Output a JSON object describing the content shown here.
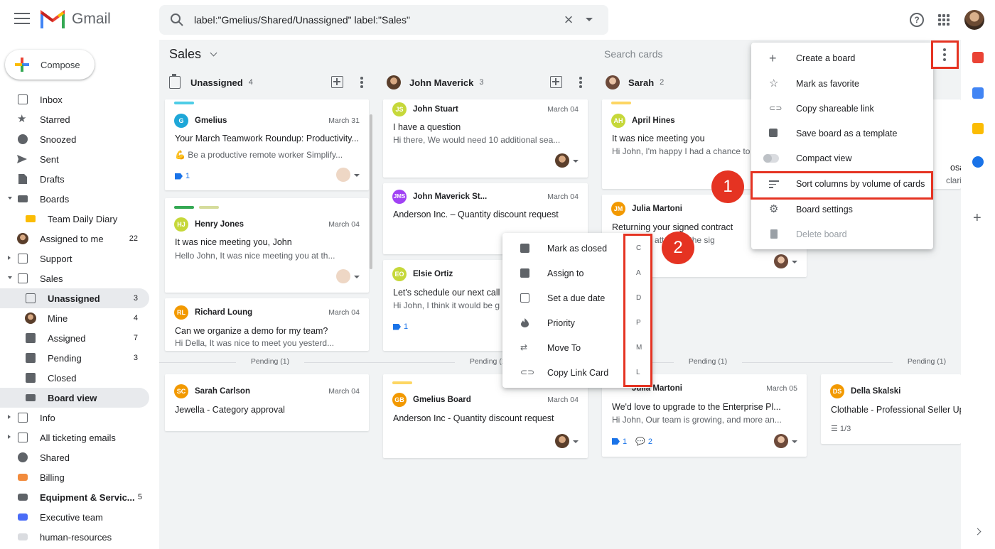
{
  "app": {
    "logo_text": "Gmail"
  },
  "search": {
    "query": "label:\"Gmelius/Shared/Unassigned\" label:\"Sales\""
  },
  "sidebar": {
    "compose": "Compose",
    "items": [
      {
        "label": "Inbox",
        "count": ""
      },
      {
        "label": "Starred",
        "count": ""
      },
      {
        "label": "Snoozed",
        "count": ""
      },
      {
        "label": "Sent",
        "count": ""
      },
      {
        "label": "Drafts",
        "count": ""
      },
      {
        "label": "Boards",
        "count": ""
      },
      {
        "label": "Team Daily Diary",
        "count": ""
      },
      {
        "label": "Assigned to me",
        "count": "22"
      },
      {
        "label": "Support",
        "count": ""
      },
      {
        "label": "Sales",
        "count": ""
      },
      {
        "label": "Unassigned",
        "count": "3"
      },
      {
        "label": "Mine",
        "count": "4"
      },
      {
        "label": "Assigned",
        "count": "7"
      },
      {
        "label": "Pending",
        "count": "3"
      },
      {
        "label": "Closed",
        "count": ""
      },
      {
        "label": "Board view",
        "count": ""
      },
      {
        "label": "Info",
        "count": ""
      },
      {
        "label": "All ticketing emails",
        "count": ""
      },
      {
        "label": "Shared",
        "count": ""
      },
      {
        "label": "Billing",
        "count": ""
      },
      {
        "label": "Equipment & Servic...",
        "count": "5"
      },
      {
        "label": "Executive team",
        "count": ""
      },
      {
        "label": "human-resources",
        "count": ""
      }
    ]
  },
  "board": {
    "title": "Sales",
    "search_placeholder": "Search cards",
    "pending_label": "Pending (1)",
    "columns": [
      {
        "name": "Unassigned",
        "count": "4",
        "cards": [
          {
            "from": "Gmelius",
            "initials": "G",
            "date": "March 31",
            "subject": "Your March Teamwork Roundup: Productivity...",
            "snippet": "💪 Be a productive remote worker Simplify...",
            "tag_count": "1"
          },
          {
            "from": "Henry Jones",
            "initials": "HJ",
            "date": "March 04",
            "subject": "It was nice meeting you, John",
            "snippet": "Hello John, It was nice meeting you at th..."
          },
          {
            "from": "Richard Loung",
            "initials": "RL",
            "date": "March 04",
            "subject": "Can we organize a demo for my team?",
            "snippet": "Hi Della, It was nice to meet you yesterd..."
          },
          {
            "from": "Sarah Carlson",
            "initials": "SC",
            "date": "March 04",
            "subject": "Jewella - Category approval"
          }
        ]
      },
      {
        "name": "John Maverick",
        "count": "3",
        "cards": [
          {
            "from": "John Stuart",
            "initials": "JS",
            "date": "March 04",
            "subject": "I have a question",
            "snippet": "Hi there, We would need 10 additional sea..."
          },
          {
            "from": "John Maverick St...",
            "initials": "JMS",
            "date": "March 04",
            "subject": "Anderson Inc. – Quantity discount request"
          },
          {
            "from": "Elsie Ortiz",
            "initials": "EO",
            "subject": "Let's schedule our next call",
            "snippet": "Hi John, I think it would be g",
            "tag_count": "1"
          },
          {
            "from": "Gmelius Board",
            "initials": "GB",
            "date": "March 04",
            "subject": "Anderson Inc - Quantity discount request"
          }
        ]
      },
      {
        "name": "Sarah",
        "count": "2",
        "cards": [
          {
            "from": "April Hines",
            "initials": "AH",
            "subject": "It was nice meeting you",
            "snippet": "Hi John, I'm happy I had a chance to"
          },
          {
            "from": "Julia Martoni",
            "initials": "JM",
            "subject": "Returning your signed contract",
            "snippet": "Hi Jo    ease    attached the sig"
          },
          {
            "from": "Julia Martoni",
            "date": "March 05",
            "subject": "We'd love to upgrade to the Enterprise Pl...",
            "snippet": "Hi John, Our team is growing, and more an...",
            "tag_count": "1",
            "comment_count": "2"
          }
        ]
      },
      {
        "name": "",
        "cards": [
          {
            "from": "Della Skalski",
            "initials": "DS",
            "subject": "Clothable - Professional Seller Up",
            "checklist": "1/3"
          }
        ],
        "partial_text": [
          "osal",
          "clarify"
        ]
      }
    ]
  },
  "card_menu": {
    "items": [
      {
        "label": "Mark as closed",
        "key": "C"
      },
      {
        "label": "Assign to",
        "key": "A"
      },
      {
        "label": "Set a due date",
        "key": "D"
      },
      {
        "label": "Priority",
        "key": "P"
      },
      {
        "label": "Move To",
        "key": "M"
      },
      {
        "label": "Copy Link Card",
        "key": "L"
      }
    ]
  },
  "board_menu": {
    "items": [
      {
        "label": "Create a board"
      },
      {
        "label": "Mark as favorite"
      },
      {
        "label": "Copy shareable link"
      },
      {
        "label": "Save board as a template"
      },
      {
        "label": "Compact view"
      },
      {
        "label": "Sort columns by volume of cards"
      },
      {
        "label": "Board settings"
      },
      {
        "label": "Delete board"
      }
    ]
  },
  "annotations": {
    "step1": "1",
    "step2": "2",
    "highlight_color": "#e53322"
  },
  "colors": {
    "tag_teal": "#4ecde6",
    "tag_green": "#34a853",
    "tag_lime": "#c6da8e",
    "tag_yellow": "#fdd663",
    "link_blue": "#1a73e8"
  }
}
